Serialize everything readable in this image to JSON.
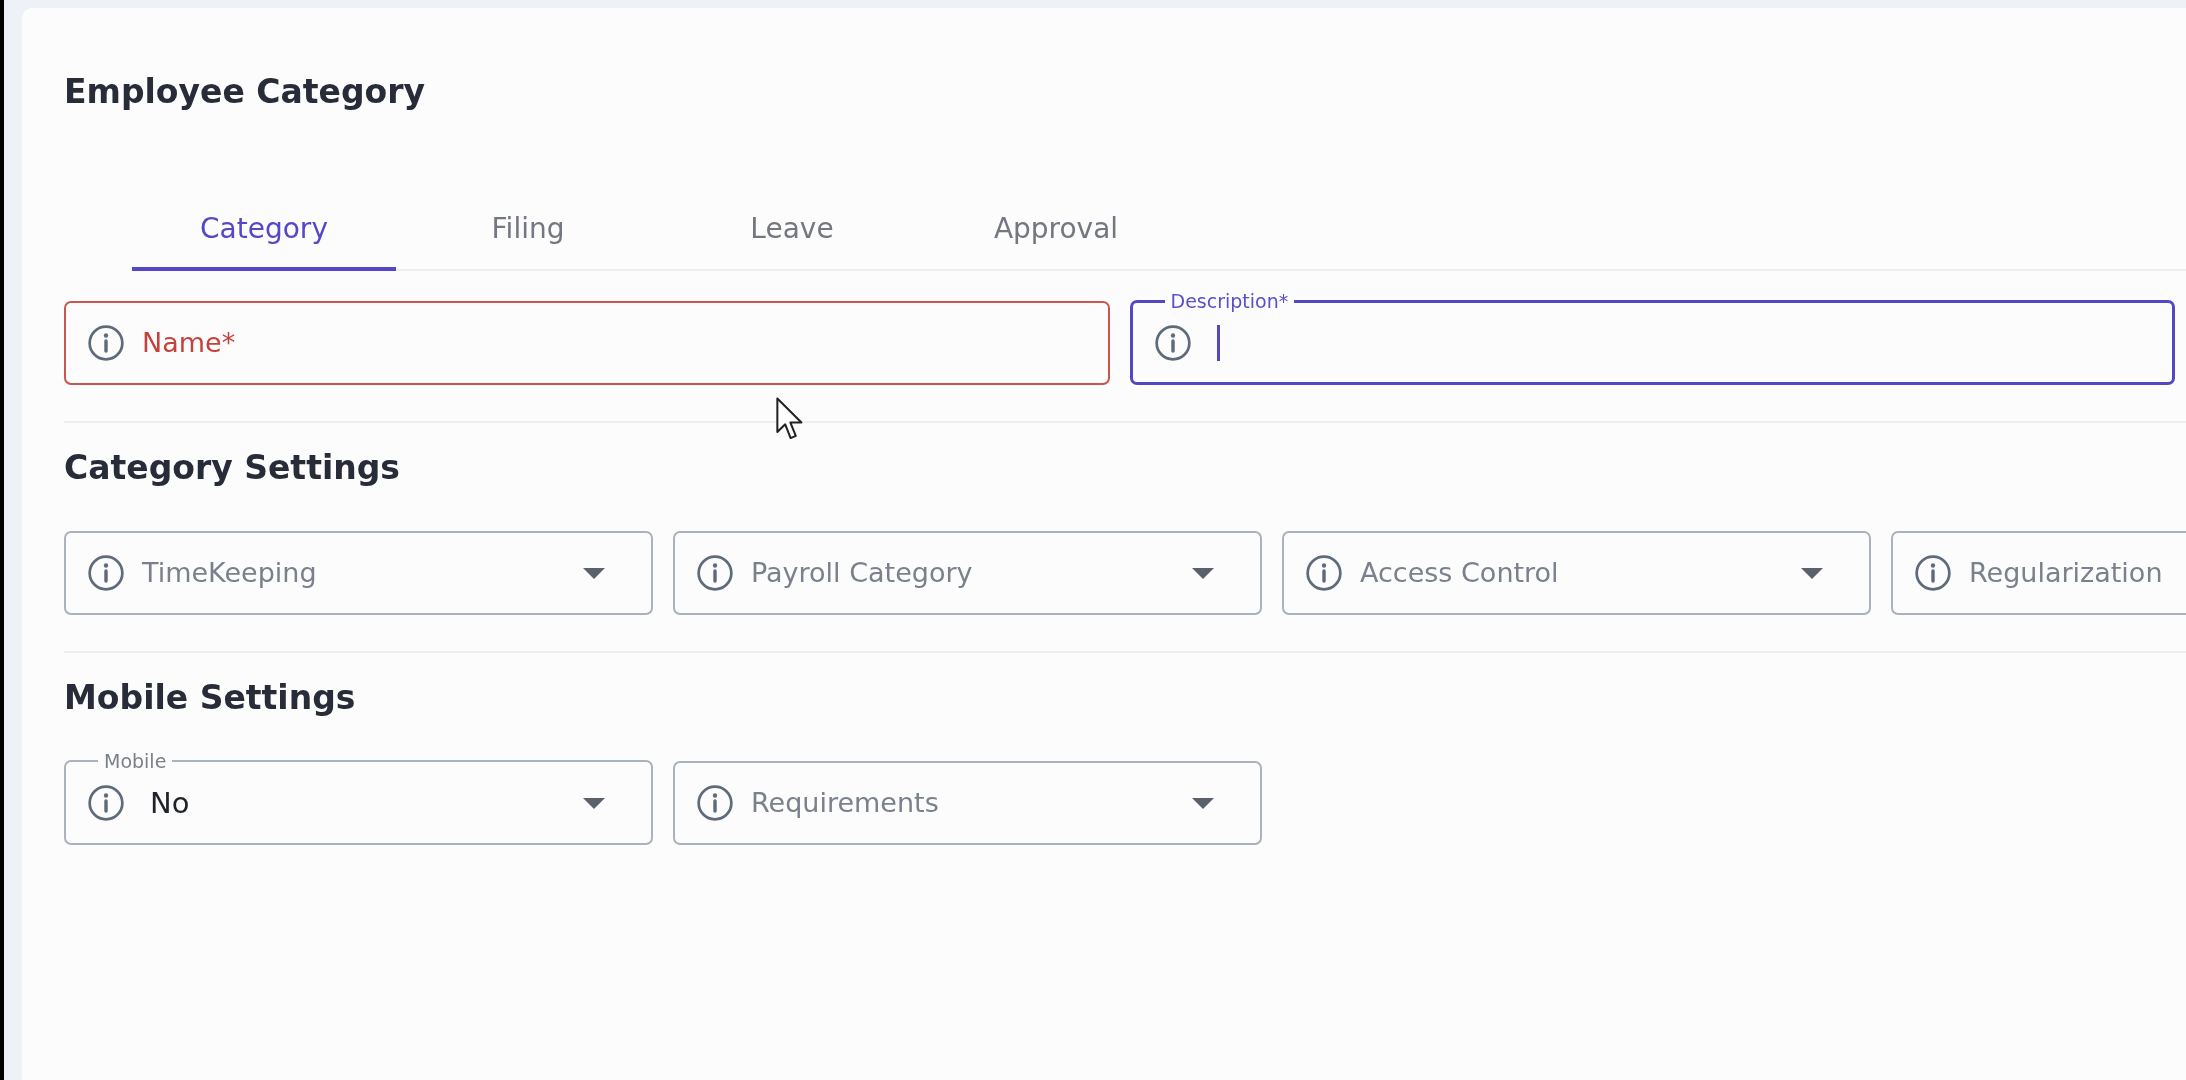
{
  "title": "Employee Category",
  "tabs": [
    {
      "label": "Category",
      "selected": true
    },
    {
      "label": "Filing",
      "selected": false
    },
    {
      "label": "Leave",
      "selected": false
    },
    {
      "label": "Approval",
      "selected": false
    }
  ],
  "text_fields": [
    {
      "label": "Name*",
      "error": true,
      "focused": false
    },
    {
      "label": "Description*",
      "error": false,
      "focused": true
    }
  ],
  "sections": [
    {
      "heading": "Category Settings",
      "dropdowns": [
        {
          "label": "TimeKeeping"
        },
        {
          "label": "Payroll Category"
        },
        {
          "label": "Access Control"
        },
        {
          "label": "Regularization"
        }
      ]
    },
    {
      "heading": "Mobile Settings",
      "dropdowns": [
        {
          "label": "Mobile",
          "value": "No"
        },
        {
          "label": "Requirements"
        }
      ]
    }
  ]
}
